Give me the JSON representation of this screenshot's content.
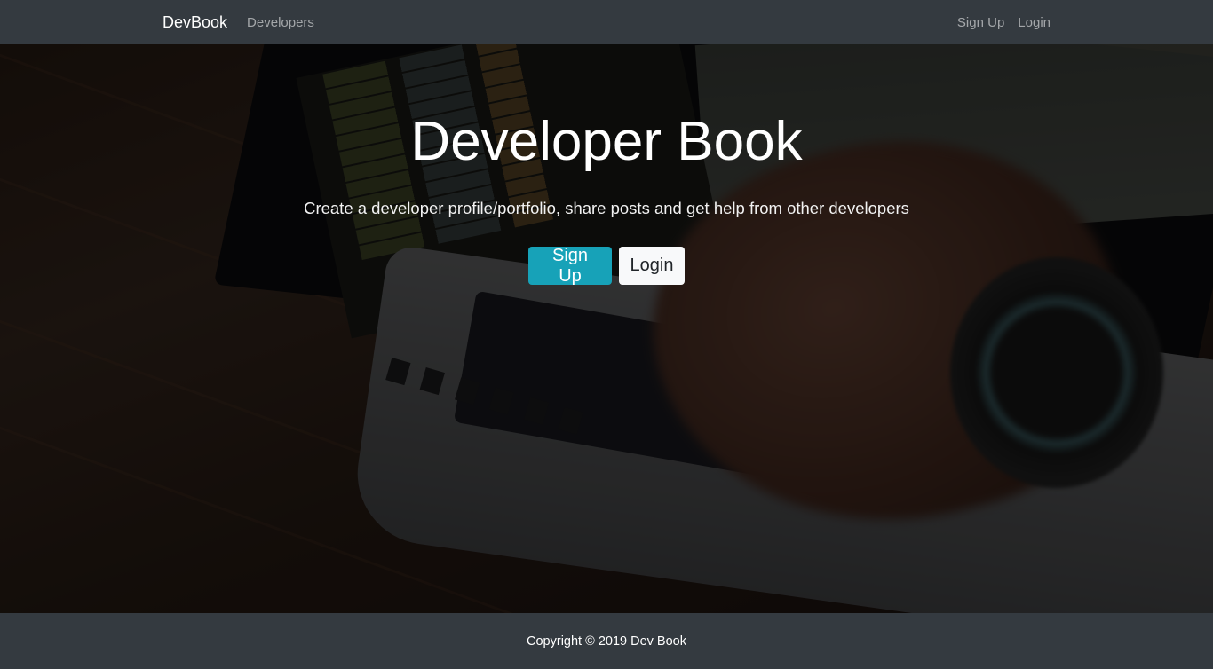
{
  "navbar": {
    "brand": "DevBook",
    "links": [
      "Developers"
    ],
    "right_links": [
      "Sign Up",
      "Login"
    ]
  },
  "hero": {
    "title": "Developer Book",
    "subtitle": "Create a developer profile/portfolio, share posts and get help from other developers",
    "signup_label": "Sign Up",
    "login_label": "Login"
  },
  "footer": {
    "copyright": "Copyright © 2019 Dev Book"
  },
  "colors": {
    "navbar_bg": "#343a40",
    "accent_info": "#17a2b8",
    "light_button": "#f8f9fa"
  }
}
